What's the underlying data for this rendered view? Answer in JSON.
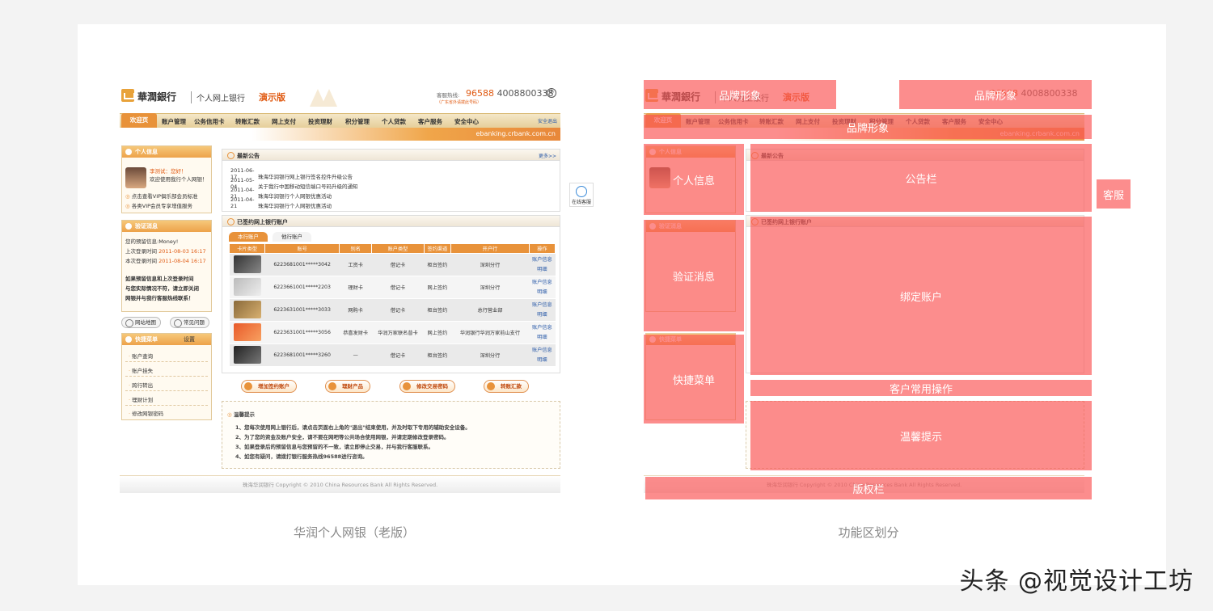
{
  "bank": {
    "brand": "華潤銀行",
    "sub_brand": "个人网上银行",
    "demo_label": "演示版",
    "hotline_label": "客服热线:",
    "hotline_primary": "96588",
    "hotline_secondary": "4008800338",
    "hotline_note": "（广东省外请拨此号码）",
    "nav_home": "欢迎页",
    "nav_items": [
      "账户管理",
      "公务信用卡",
      "转账汇款",
      "网上支付",
      "投资理财",
      "积分管理",
      "个人贷款",
      "客户服务",
      "安全中心"
    ],
    "logout": "安全退出",
    "url": "ebanking.crbank.com.cn",
    "personal_title": "个人信息",
    "greet_name": "李测试：您好！",
    "greet_text": "欢迎使用我行个人网银！",
    "vip_link1": "点击查看VIP俱乐部会员标准",
    "vip_link2": "各类VIP会员专享增值服务",
    "verify_title": "验证消息",
    "verify_msg": "您的预留信息:Money!",
    "last_login_label": "上次登录时间",
    "last_login": "2011-08-03 16:17",
    "this_login_label": "本次登录时间",
    "this_login": "2011-08-04 16:17",
    "warn_text": [
      "如果预留信息和上次登录时间",
      "与您实际情况不符，请立即关闭",
      "网银并与我行客服热线联系！"
    ],
    "sitemap": "网站地图",
    "faq": "常见问题",
    "quick_title": "快捷菜单",
    "quick_settings": "设置",
    "quick_items": [
      "账户查询",
      "账户挂失",
      "跨行转出",
      "理财计划",
      "修改网银密码"
    ],
    "notice_title": "最新公告",
    "more": "更多>>",
    "notices": [
      {
        "date": "2011-06-17",
        "text": "珠海华润银行网上银行签名控件升级公告"
      },
      {
        "date": "2011-05-04",
        "text": "关于我行中国移动短信端口号码升级的通知"
      },
      {
        "date": "2011-04-21",
        "text": "珠海华润银行个人网银优惠活动"
      },
      {
        "date": "2011-04-21",
        "text": "珠海华润银行个人网银优惠活动"
      }
    ],
    "accounts_title": "已签约网上银行账户",
    "tab_own": "本行账户",
    "tab_other": "他行账户",
    "columns": [
      "卡片类型",
      "账号",
      "别名",
      "账户类型",
      "签约渠道",
      "开户行",
      "操作"
    ],
    "rows": [
      {
        "acct": "6223681001*****3042",
        "alias": "工资卡",
        "type": "借记卡",
        "channel": "柜台签约",
        "branch": "深圳分行"
      },
      {
        "acct": "6223661001*****2203",
        "alias": "理财卡",
        "type": "借记卡",
        "channel": "网上签约",
        "branch": "深圳分行"
      },
      {
        "acct": "6223631001*****3033",
        "alias": "网购卡",
        "type": "借记卡",
        "channel": "柜台签约",
        "branch": "总行营业部"
      },
      {
        "acct": "6223631001*****3056",
        "alias": "恭喜发财卡",
        "type": "华润万家联名普卡",
        "channel": "网上签约",
        "branch": "华润银行华润万家前山支行"
      },
      {
        "acct": "6223681001*****3260",
        "alias": "—",
        "type": "借记卡",
        "channel": "柜台签约",
        "branch": "深圳分行"
      }
    ],
    "op_info": "账户信息",
    "op_detail": "明细",
    "actions": [
      "增加签约账户",
      "理财产品",
      "修改交易密码",
      "转账汇款"
    ],
    "tips_title": "温馨提示",
    "tips": [
      "1、您每次使用网上银行后，请点击页面右上角的\"退出\"结束使用，并及时取下专用的辅助安全设备。",
      "2、为了您的资金及账户安全，请不要在网吧等公共场合使用网银，并请定期修改登录密码。",
      "3、如果登录后的预留信息与您预留的不一致，请立即停止交易，并与我行客服联系。",
      "4、如您有疑问，请拨打银行服务热线96588进行咨询。"
    ],
    "footer": "珠海华润银行 Copyright © 2010 China Resources Bank All Rights Reserved.",
    "service_label": "在线客服"
  },
  "overlay_labels": {
    "brand1": "品牌形象",
    "brand2": "品牌形象",
    "brand3": "品牌形象",
    "personal": "个人信息",
    "notice": "公告栏",
    "service": "客服",
    "verify": "验证消息",
    "accounts": "绑定账户",
    "quick": "快捷菜单",
    "actions": "客户常用操作",
    "tips": "温馨提示",
    "copyright": "版权栏"
  },
  "captions": {
    "left": "华润个人网银（老版）",
    "right": "功能区划分"
  },
  "watermark": "头条 @视觉设计工坊",
  "colors": {
    "accent": "#e8923a",
    "overlay": "#fa5050",
    "link": "#2a5aa8"
  }
}
